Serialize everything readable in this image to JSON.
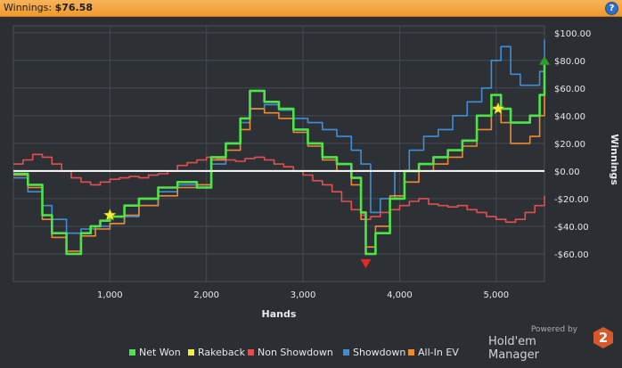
{
  "header": {
    "label": "Winnings:",
    "amount": "$76.58",
    "help_icon": "question-icon"
  },
  "chart_data": {
    "type": "line",
    "xlabel": "Hands",
    "ylabel": "Winnings",
    "xlim": [
      0,
      5500
    ],
    "ylim": [
      -80,
      105
    ],
    "xticks": [
      1000,
      2000,
      3000,
      4000,
      5000
    ],
    "xtick_labels": [
      "1,000",
      "2,000",
      "3,000",
      "4,000",
      "5,000"
    ],
    "yticks": [
      100,
      80,
      60,
      40,
      20,
      0,
      -20,
      -40,
      -60
    ],
    "ytick_labels": [
      "$100.00",
      "$80.00",
      "$60.00",
      "$40.00",
      "$20.00",
      "$0.00",
      "-$20.00",
      "-$40.00",
      "-$60.00"
    ],
    "grid": true,
    "legend_position": "bottom",
    "series": [
      {
        "name": "Net Won",
        "color": "#4fe34a",
        "x": [
          0,
          150,
          300,
          400,
          550,
          700,
          800,
          900,
          1000,
          1150,
          1300,
          1500,
          1700,
          1900,
          2050,
          2200,
          2350,
          2450,
          2600,
          2750,
          2900,
          3050,
          3200,
          3350,
          3500,
          3600,
          3650,
          3750,
          3900,
          4050,
          4200,
          4350,
          4500,
          4650,
          4800,
          4950,
          5050,
          5150,
          5250,
          5350,
          5450,
          5500
        ],
        "y": [
          -2,
          -10,
          -32,
          -45,
          -60,
          -45,
          -40,
          -36,
          -33,
          -25,
          -20,
          -12,
          -8,
          -12,
          10,
          20,
          38,
          58,
          50,
          45,
          30,
          20,
          10,
          5,
          -5,
          -30,
          -60,
          -45,
          -20,
          0,
          5,
          10,
          15,
          22,
          40,
          55,
          45,
          35,
          35,
          40,
          55,
          78
        ]
      },
      {
        "name": "Rakeback",
        "color": "#f4ee3a",
        "x": [],
        "y": []
      },
      {
        "name": "Non Showdown",
        "color": "#e0504f",
        "x": [
          0,
          100,
          200,
          300,
          400,
          500,
          600,
          700,
          800,
          900,
          1000,
          1100,
          1200,
          1300,
          1400,
          1500,
          1600,
          1700,
          1800,
          1900,
          2000,
          2100,
          2200,
          2300,
          2400,
          2500,
          2600,
          2700,
          2800,
          2900,
          3000,
          3100,
          3200,
          3300,
          3400,
          3500,
          3600,
          3650,
          3700,
          3800,
          3900,
          4000,
          4100,
          4200,
          4300,
          4400,
          4500,
          4600,
          4700,
          4800,
          4900,
          5000,
          5100,
          5200,
          5300,
          5400,
          5500
        ],
        "y": [
          5,
          8,
          12,
          10,
          5,
          0,
          -5,
          -8,
          -10,
          -8,
          -6,
          -5,
          -4,
          -5,
          -3,
          -2,
          0,
          4,
          6,
          8,
          10,
          9,
          8,
          7,
          9,
          10,
          8,
          5,
          3,
          0,
          -3,
          -7,
          -10,
          -15,
          -22,
          -28,
          -32,
          -35,
          -33,
          -30,
          -28,
          -25,
          -22,
          -20,
          -24,
          -25,
          -26,
          -25,
          -28,
          -30,
          -33,
          -35,
          -37,
          -35,
          -30,
          -25,
          -18
        ]
      },
      {
        "name": "Showdown",
        "color": "#3f8ed8",
        "x": [
          0,
          150,
          300,
          400,
          550,
          700,
          850,
          1000,
          1150,
          1300,
          1500,
          1700,
          1900,
          2050,
          2200,
          2350,
          2450,
          2600,
          2750,
          2900,
          3050,
          3200,
          3350,
          3500,
          3600,
          3700,
          3800,
          3950,
          4100,
          4250,
          4400,
          4550,
          4700,
          4850,
          4950,
          5050,
          5150,
          5250,
          5350,
          5450,
          5500
        ],
        "y": [
          -5,
          -15,
          -25,
          -35,
          -45,
          -42,
          -40,
          -38,
          -33,
          -25,
          -15,
          -10,
          -10,
          5,
          20,
          35,
          45,
          48,
          44,
          38,
          35,
          30,
          25,
          15,
          5,
          -30,
          -20,
          0,
          15,
          25,
          30,
          40,
          50,
          60,
          80,
          90,
          70,
          62,
          62,
          72,
          95
        ]
      },
      {
        "name": "All-In EV",
        "color": "#ee8a2f",
        "x": [
          0,
          150,
          300,
          400,
          550,
          700,
          850,
          1000,
          1150,
          1300,
          1500,
          1700,
          1900,
          2050,
          2200,
          2350,
          2450,
          2600,
          2750,
          2900,
          3050,
          3200,
          3350,
          3500,
          3600,
          3650,
          3750,
          3900,
          4050,
          4200,
          4350,
          4500,
          4650,
          4800,
          4950,
          5050,
          5150,
          5250,
          5350,
          5450,
          5500
        ],
        "y": [
          -3,
          -12,
          -35,
          -48,
          -58,
          -47,
          -42,
          -38,
          -32,
          -25,
          -18,
          -12,
          -10,
          8,
          15,
          30,
          45,
          42,
          38,
          28,
          18,
          8,
          0,
          -10,
          -35,
          -55,
          -40,
          -18,
          -8,
          0,
          5,
          10,
          18,
          30,
          45,
          35,
          20,
          20,
          25,
          40,
          55
        ]
      }
    ],
    "markers": [
      {
        "type": "star",
        "x": 1000,
        "y": -32,
        "color": "#f4ee3a"
      },
      {
        "type": "star",
        "x": 5020,
        "y": 45,
        "color": "#f4ee3a"
      },
      {
        "type": "down-triangle",
        "x": 3650,
        "y": -67,
        "color": "#e52828"
      },
      {
        "type": "up-triangle",
        "x": 5500,
        "y": 80,
        "color": "#2e9b2e"
      }
    ]
  },
  "branding": {
    "powered_by": "Powered by",
    "product": "Hold'em Manager",
    "badge": "2"
  }
}
